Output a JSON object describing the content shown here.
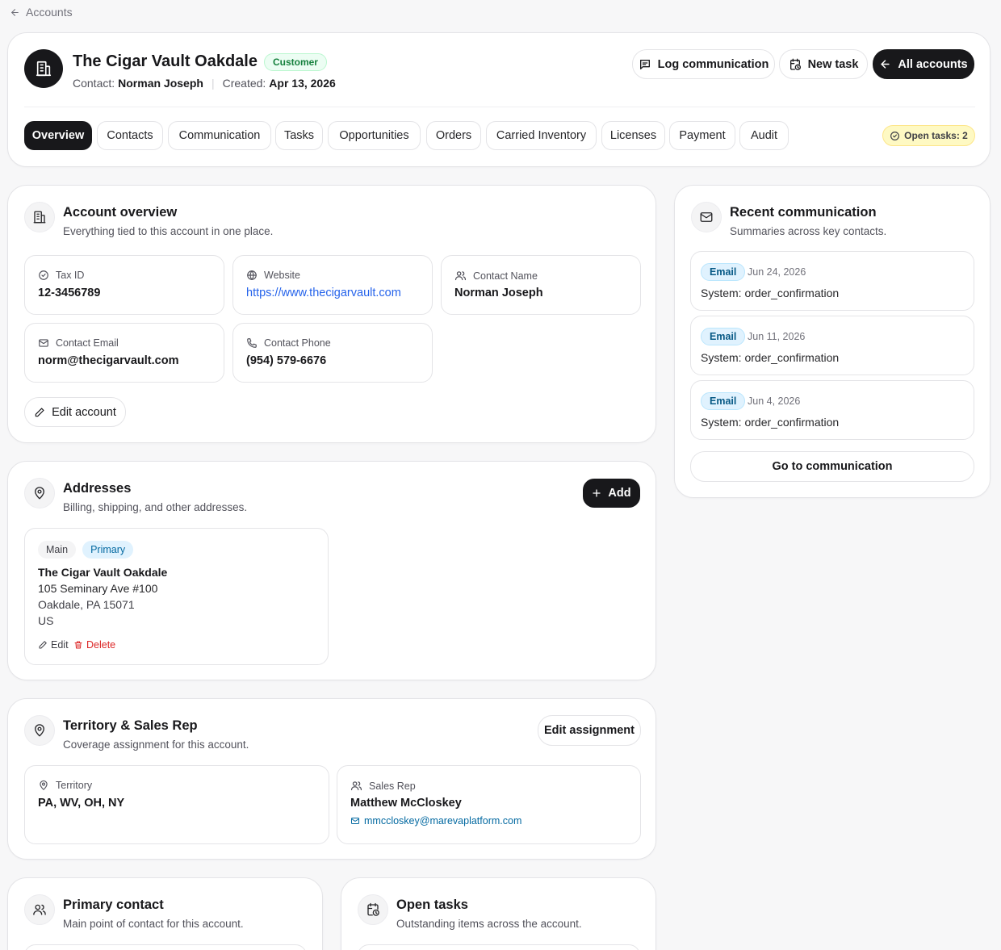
{
  "breadcrumb": {
    "label": "Accounts"
  },
  "header": {
    "account_name": "The Cigar Vault Oakdale",
    "status_badge": "Customer",
    "contact_label": "Contact:",
    "contact_name": "Norman Joseph",
    "created_label": "Created:",
    "created_date": "Apr 13, 2026",
    "buttons": {
      "log_communication": "Log communication",
      "new_task": "New task",
      "all_accounts": "All accounts"
    },
    "open_tasks_badge": "Open tasks: 2"
  },
  "tabs": [
    {
      "label": "Overview",
      "active": true
    },
    {
      "label": "Contacts"
    },
    {
      "label": "Communication"
    },
    {
      "label": "Tasks"
    },
    {
      "label": "Opportunities"
    },
    {
      "label": "Orders"
    },
    {
      "label": "Carried Inventory"
    },
    {
      "label": "Licenses"
    },
    {
      "label": "Payment"
    },
    {
      "label": "Audit"
    }
  ],
  "overview": {
    "title": "Account overview",
    "subtitle": "Everything tied to this account in one place.",
    "fields": {
      "tax_id": {
        "label": "Tax ID",
        "value": "12-3456789"
      },
      "website": {
        "label": "Website",
        "value": "https://www.thecigarvault.com"
      },
      "contact_name": {
        "label": "Contact Name",
        "value": "Norman Joseph"
      },
      "contact_email": {
        "label": "Contact Email",
        "value": "norm@thecigarvault.com"
      },
      "contact_phone": {
        "label": "Contact Phone",
        "value": "(954) 579-6676"
      }
    },
    "edit_button": "Edit account"
  },
  "addresses": {
    "title": "Addresses",
    "subtitle": "Billing, shipping, and other addresses.",
    "add_button": "Add",
    "items": [
      {
        "tags": [
          "Main",
          "Primary"
        ],
        "name": "The Cigar Vault Oakdale",
        "line1": "105 Seminary Ave #100",
        "line2": "Oakdale, PA 15071",
        "country": "US",
        "edit_label": "Edit",
        "delete_label": "Delete"
      }
    ]
  },
  "territory": {
    "title": "Territory & Sales Rep",
    "subtitle": "Coverage assignment for this account.",
    "edit_button": "Edit assignment",
    "territory_label": "Territory",
    "territory_value": "PA, WV, OH, NY",
    "rep_label": "Sales Rep",
    "rep_name": "Matthew McCloskey",
    "rep_email": "mmccloskey@marevaplatform.com"
  },
  "primary_contact": {
    "title": "Primary contact",
    "subtitle": "Main point of contact for this account."
  },
  "open_tasks": {
    "title": "Open tasks",
    "subtitle": "Outstanding items across the account."
  },
  "recent_communication": {
    "title": "Recent communication",
    "subtitle": "Summaries across key contacts.",
    "items": [
      {
        "type": "Email",
        "date": "Jun 24, 2026",
        "summary": "System: order_confirmation"
      },
      {
        "type": "Email",
        "date": "Jun 11, 2026",
        "summary": "System: order_confirmation"
      },
      {
        "type": "Email",
        "date": "Jun 4, 2026",
        "summary": "System: order_confirmation"
      }
    ],
    "go_button": "Go to communication"
  },
  "colors": {
    "accent_dark": "#18181b",
    "customer_badge_bg": "#ecfdf3",
    "customer_badge_text": "#15803d",
    "open_tasks_bg": "#fef9c3",
    "primary_tag_bg": "#e0f2fe",
    "delete_red": "#dc2626",
    "link_blue": "#2563eb"
  }
}
